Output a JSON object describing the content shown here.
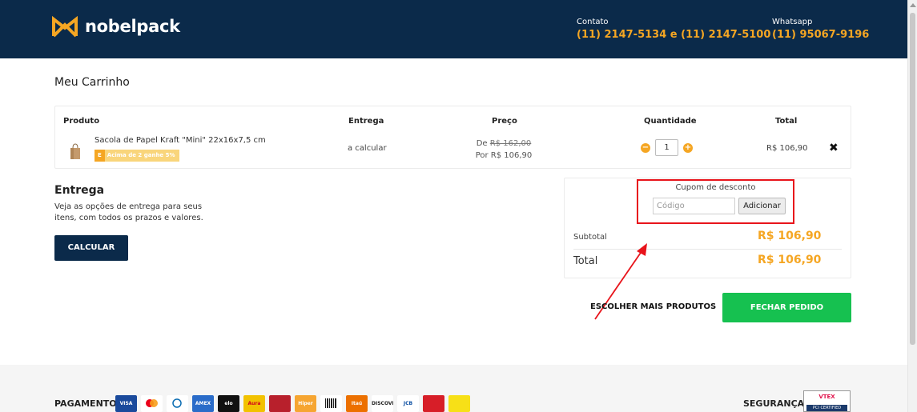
{
  "header": {
    "logo_text": "nobelpack",
    "contact_label": "Contato",
    "contact_value": "(11) 2147-5134 e (11) 2147-5100",
    "whatsapp_label": "Whatsapp",
    "whatsapp_value": "(11) 95067-9196",
    "bg_color": "#0b2a4a",
    "accent_color": "#f5a623"
  },
  "page": {
    "title": "Meu Carrinho"
  },
  "cart": {
    "columns": [
      "Produto",
      "Entrega",
      "Preço",
      "Quantidade",
      "Total"
    ],
    "item": {
      "name": "Sacola de Papel Kraft \"Mini\" 22x16x7,5 cm",
      "promo_badge": "E",
      "promo_text": "Acima de 2 ganhe 5%",
      "entrega": "a calcular",
      "price_from_label": "De",
      "price_from": "R$ 162,00",
      "price_to": "Por R$ 106,90",
      "quantity": "1",
      "total": "R$ 106,90",
      "remove_icon": "close-icon"
    }
  },
  "entrega": {
    "title": "Entrega",
    "description": "Veja as opções de entrega para seus itens, com todos os prazos e valores.",
    "button": "CALCULAR"
  },
  "summary": {
    "coupon_label": "Cupom de desconto",
    "coupon_placeholder": "Código",
    "coupon_button": "Adicionar",
    "subtotal_label": "Subtotal",
    "subtotal_value": "R$ 106,90",
    "total_label": "Total",
    "total_value": "R$ 106,90"
  },
  "actions": {
    "more_products": "ESCOLHER MAIS PRODUTOS",
    "checkout": "FECHAR PEDIDO",
    "checkout_color": "#16c150"
  },
  "footer": {
    "payment_label": "PAGAMENTO",
    "payment_methods": [
      "visa",
      "mastercard",
      "diners",
      "amex",
      "elo",
      "aura",
      "hipercard-red",
      "hiper",
      "boleto",
      "itau",
      "discover",
      "jcb",
      "bank-red",
      "banco-do-brasil"
    ],
    "payment_visible_labels": [
      "VISA",
      "",
      "",
      "AMEX",
      "elo",
      "Aura",
      "",
      "Hiper",
      "",
      "Itaú",
      "DISCOVER",
      "JCB",
      "",
      ""
    ],
    "security_label": "SEGURANÇA",
    "security_badge_top": "VTEX",
    "security_badge_bottom": "PCI CERTIFIED"
  },
  "annotation": {
    "highlight_color": "#e8141b"
  }
}
